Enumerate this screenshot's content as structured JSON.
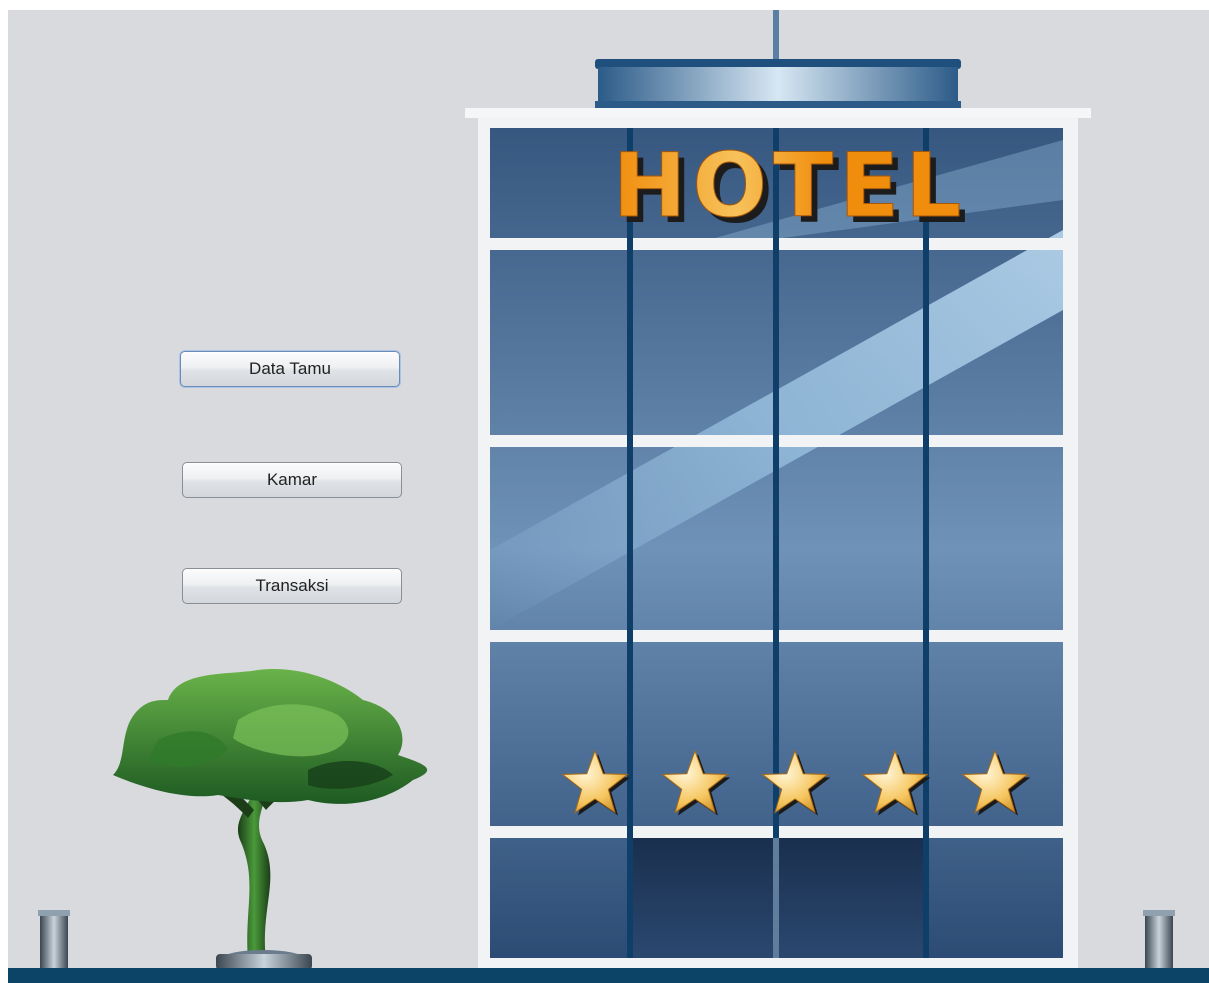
{
  "menu": {
    "items": [
      {
        "key": "data_tamu",
        "label": "Data Tamu",
        "focused": true
      },
      {
        "key": "kamar",
        "label": "Kamar",
        "focused": false
      },
      {
        "key": "transaksi",
        "label": "Transaksi",
        "focused": false
      }
    ]
  },
  "building": {
    "sign_text": "HOTEL",
    "star_rating": 5
  },
  "colors": {
    "background": "#d8dade",
    "ground": "#0c4468",
    "sign": "#f08d0d",
    "glass_dark": "#2c4a72",
    "glass_light": "#7ea8cc",
    "star": "#f6c65f",
    "tree": "#2f8a2c"
  }
}
